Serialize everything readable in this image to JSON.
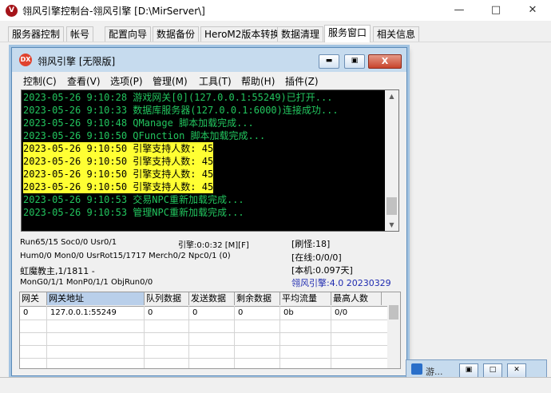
{
  "outer": {
    "title": "翎风引擎控制台-翎风引擎 [D:\\MirServer\\]",
    "icon_glyph": "V",
    "tabs": [
      "服务器控制",
      "帐号",
      "配置向导",
      "数据备份",
      "HeroM2版本转换",
      "数据清理",
      "服务窗口",
      "相关信息"
    ],
    "active_tab": "服务窗口"
  },
  "inner": {
    "title": "翎风引擎 [无限版]",
    "icon_glyph": "DX",
    "menu": [
      "控制(C)",
      "查看(V)",
      "选项(P)",
      "管理(M)",
      "工具(T)",
      "帮助(H)",
      "插件(Z)"
    ]
  },
  "log": [
    {
      "time": "2023-05-26 9:10:28",
      "msg": "游戏网关[0](127.0.0.1:55249)已打开...",
      "hl": false
    },
    {
      "time": "2023-05-26 9:10:33",
      "msg": "数据库服务器(127.0.0.1:6000)连接成功...",
      "hl": false
    },
    {
      "time": "2023-05-26 9:10:48",
      "msg": "QManage 脚本加载完成...",
      "hl": false
    },
    {
      "time": "2023-05-26 9:10:50",
      "msg": "QFunction 脚本加载完成...",
      "hl": false
    },
    {
      "time": "2023-05-26 9:10:50",
      "msg": "引擎支持人数: 45",
      "hl": true
    },
    {
      "time": "2023-05-26 9:10:50",
      "msg": "引擎支持人数: 45",
      "hl": true
    },
    {
      "time": "2023-05-26 9:10:50",
      "msg": "引擎支持人数: 45",
      "hl": true
    },
    {
      "time": "2023-05-26 9:10:50",
      "msg": "引擎支持人数: 45",
      "hl": true
    },
    {
      "time": "2023-05-26 9:10:53",
      "msg": "交易NPC重新加载完成...",
      "hl": false
    },
    {
      "time": "2023-05-26 9:10:53",
      "msg": "管理NPC重新加载完成...",
      "hl": false
    }
  ],
  "status": {
    "line1": "Run65/15 Soc0/0 Usr0/1",
    "engine_time": "引擎:0:0:32 [M][F]",
    "refresh": "[刷怪:18]",
    "line2": "Hum0/0 Mon0/0 UsrRot15/1717 Merch0/2 Npc0/1 (0)",
    "online": "[在线:0/0/0]",
    "line3": "虹魔教主,1/1811 -",
    "local": "[本机:0.097天]",
    "line4": "MonG0/1/1 MonP0/1/1 ObjRun0/0",
    "version": "翎风引擎:4.0 20230329"
  },
  "grid": {
    "columns": [
      "网关",
      "网关地址",
      "队列数据",
      "发送数据",
      "剩余数据",
      "平均流量",
      "最高人数"
    ],
    "rows": [
      [
        "0",
        "127.0.0.1:55249",
        "0",
        "0",
        "0",
        "0b",
        "0/0"
      ]
    ]
  },
  "minimized": {
    "label": "游..."
  }
}
